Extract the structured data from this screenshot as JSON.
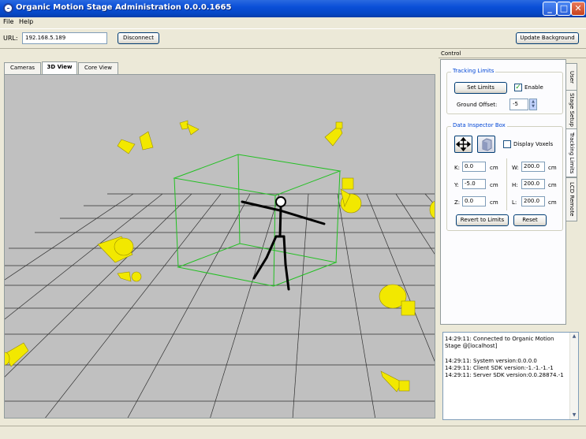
{
  "window": {
    "title": "Organic Motion Stage Administration 0.0.0.1665",
    "minimize_glyph": "_",
    "maximize_glyph": "□",
    "close_glyph": "✕"
  },
  "menu": [
    "File",
    "Help"
  ],
  "toolbar": {
    "url_label": "URL:",
    "url_value": "192.168.5.189",
    "disconnect_label": "Disconnect",
    "update_background_label": "Update Background"
  },
  "view_tabs": [
    "Cameras",
    "3D View",
    "Core View"
  ],
  "control": {
    "header": "Control",
    "side_tabs": [
      "User",
      "Stage Setup",
      "Tracking Limits",
      "LCD Remote"
    ],
    "tracking_limits": {
      "title": "Tracking Limits",
      "set_limits_label": "Set Limits",
      "enable_label": "Enable",
      "enable_checked": true,
      "ground_offset_label": "Ground Offset:",
      "ground_offset_value": "-5"
    },
    "data_inspector": {
      "title": "Data Inspector Box",
      "display_voxels_label": "Display Voxels",
      "display_voxels_checked": false,
      "fields": {
        "k_label": "K:",
        "k_value": "0.0",
        "w_label": "W:",
        "w_value": "200.0",
        "y_label": "Y:",
        "y_value": "-5.0",
        "h_label": "H:",
        "h_value": "200.0",
        "z_label": "Z:",
        "z_value": "0.0",
        "l_label": "L:",
        "l_value": "200.0",
        "unit": "cm"
      },
      "revert_label": "Revert to Limits",
      "reset_label": "Reset"
    }
  },
  "log": [
    "14:29:11: Connected to Organic Motion",
    "Stage @[localhost]",
    "",
    "14:29:11: System version:0.0.0.0",
    "14:29:11: Client SDK version:-1.-1.-1.-1",
    "14:29:11: Server SDK version:0.0.28874.-1"
  ],
  "colors": {
    "titlebar": "#0a4fd8",
    "viewport_bg": "#c0c0c0",
    "camera_yellow": "#f2e800",
    "bbox_green": "#22c022",
    "group_title_blue": "#0046d5"
  }
}
